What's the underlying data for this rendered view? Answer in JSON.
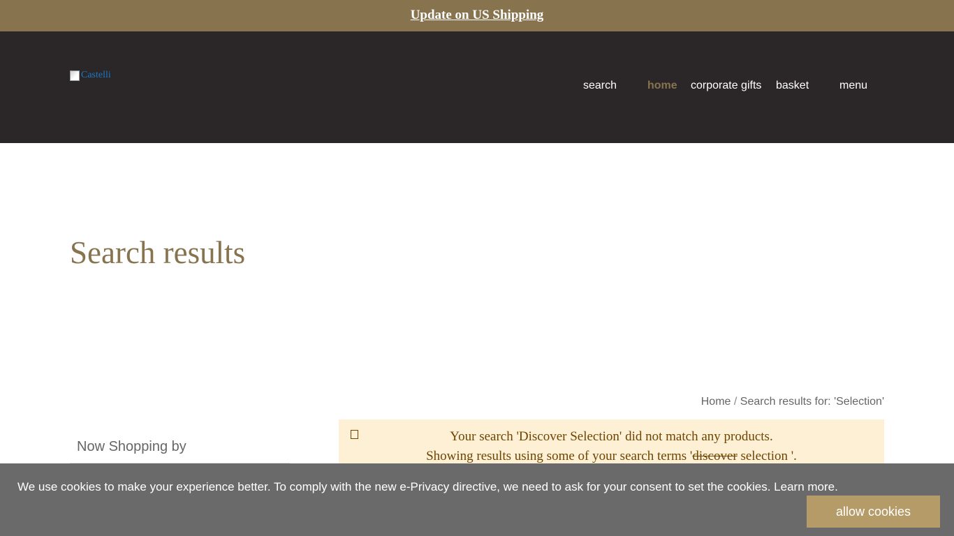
{
  "announcement": {
    "link_text": "Update on US Shipping"
  },
  "header": {
    "logo_alt": "Castelli",
    "nav": {
      "search": "search",
      "home": "home",
      "corporate_gifts": "corporate gifts",
      "basket": "basket",
      "menu": "menu"
    }
  },
  "page": {
    "title": "Search results"
  },
  "breadcrumbs": {
    "home": "Home",
    "separator": "/",
    "current": "Search results for: 'Selection'"
  },
  "sidebar": {
    "title": "Now Shopping by"
  },
  "notice": {
    "line1": "Your search 'Discover Selection' did not match any products.",
    "line2_prefix": "Showing results using some of your search terms '",
    "line2_struck": "discover",
    "line2_suffix": " selection '."
  },
  "cookie_bar": {
    "message": "We use cookies to make your experience better. To comply with the new e-Privacy directive, we need to ask for your consent to set the cookies. Learn more.",
    "button_label": "allow cookies"
  },
  "colors": {
    "brand_gold": "#87744f",
    "header_dark": "#2b2728",
    "notice_bg": "#fdf0d5",
    "cookie_bg": "#6a6a6a",
    "cookie_button": "#b59b67"
  }
}
